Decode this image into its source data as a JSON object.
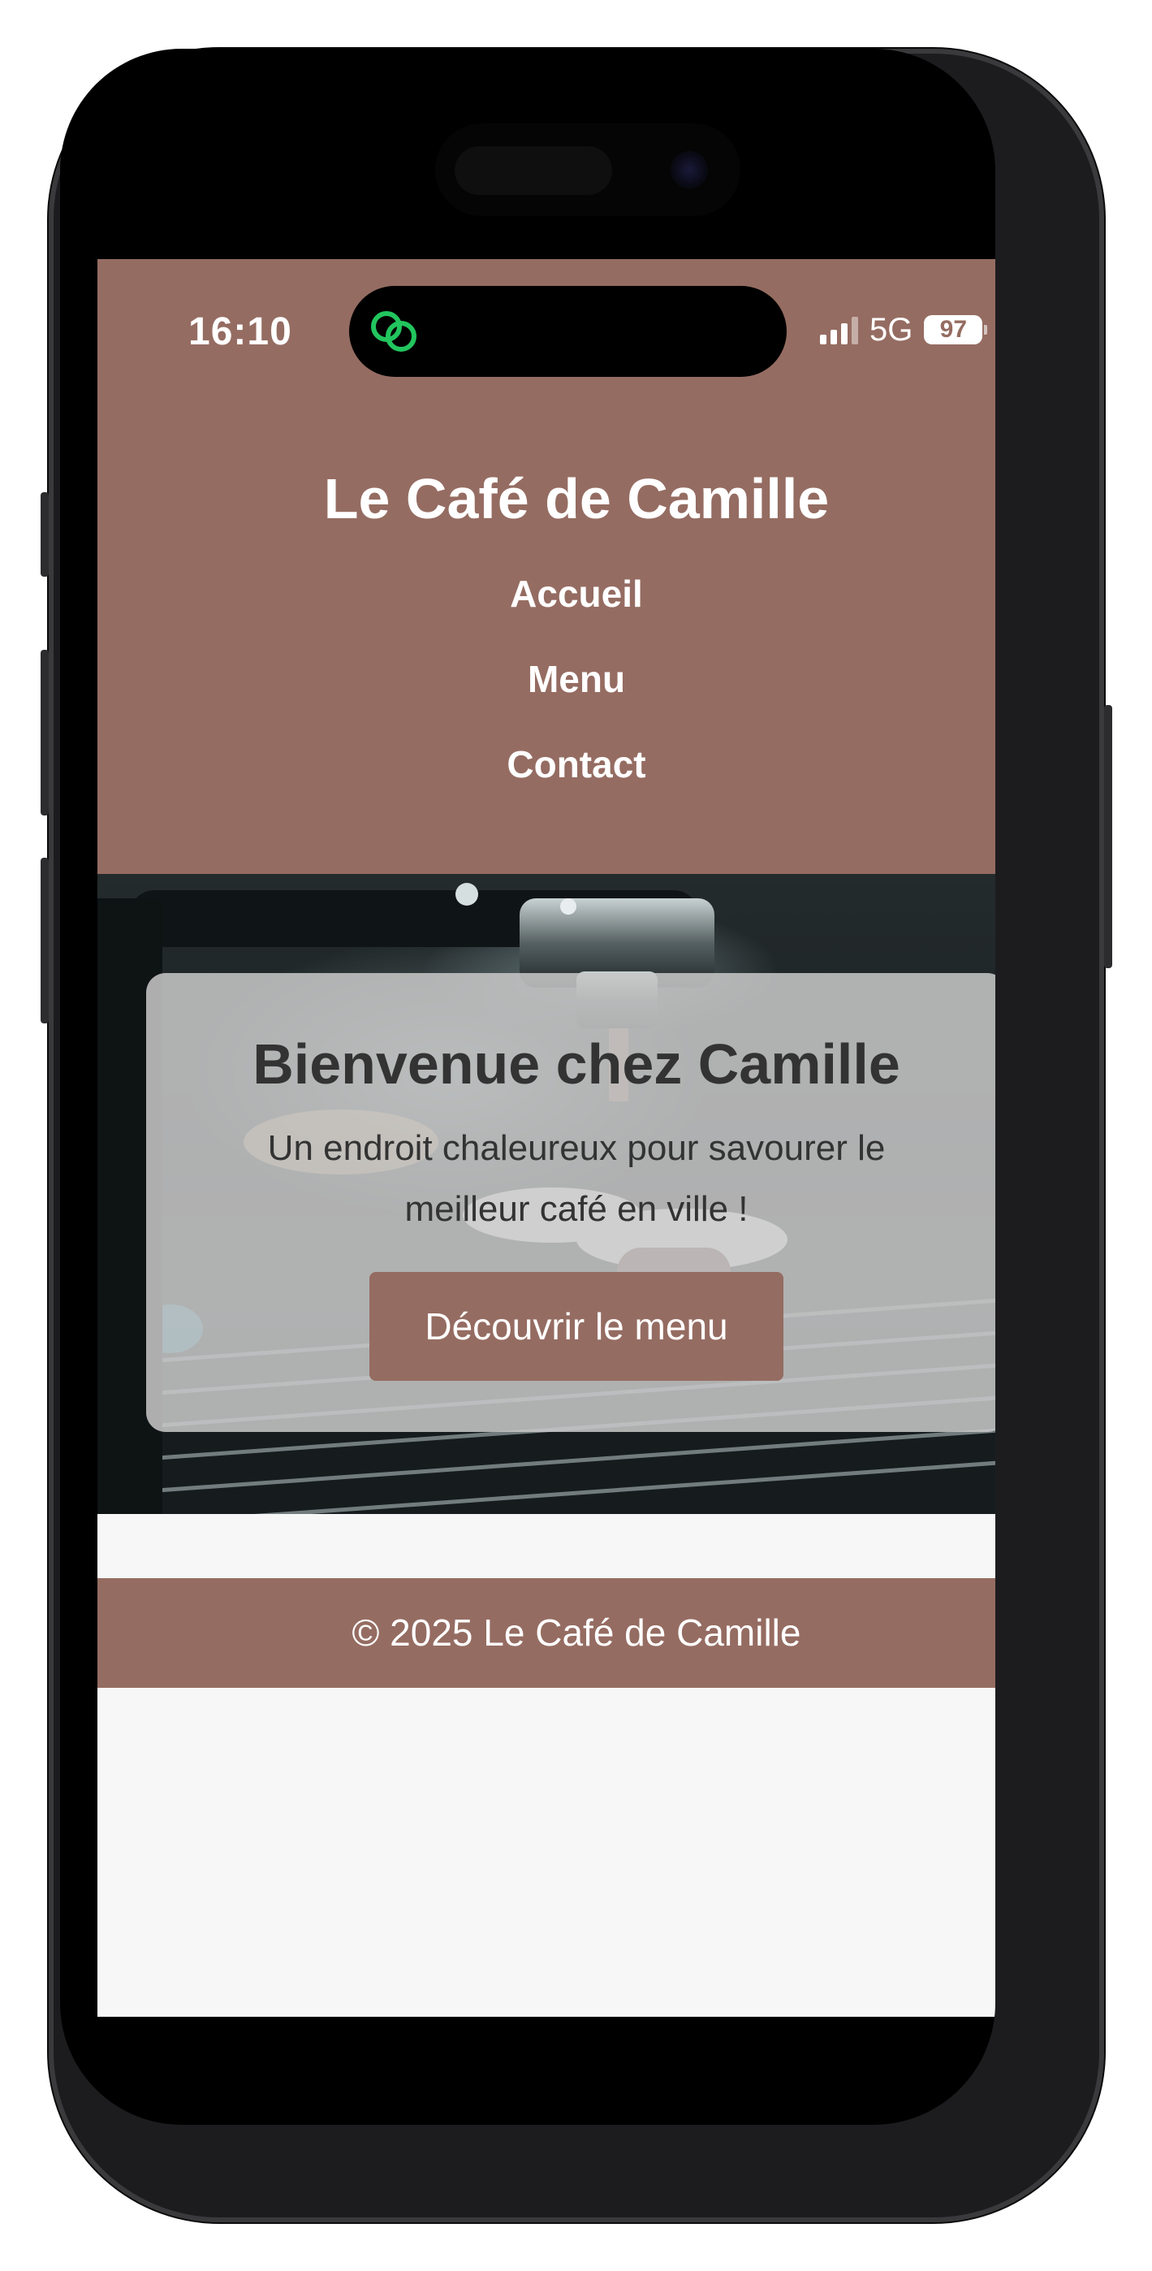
{
  "status_bar": {
    "time": "16:10",
    "network": "5G",
    "battery": "97",
    "activity_icon": "linked-circles-icon"
  },
  "header": {
    "title": "Le Café de Camille",
    "nav": [
      {
        "label": "Accueil"
      },
      {
        "label": "Menu"
      },
      {
        "label": "Contact"
      }
    ]
  },
  "hero": {
    "title": "Bienvenue chez Camille",
    "text": "Un endroit chaleureux pour savourer le meilleur café en ville !",
    "button_label": "Découvrir le menu",
    "background_image": "espresso-machine-photo"
  },
  "footer": {
    "text": "© 2025 Le Café de Camille"
  },
  "colors": {
    "brand": "#956c62",
    "page_bg": "#f7f7f7",
    "text_dark": "#333333",
    "island_icon": "#22c55e"
  }
}
